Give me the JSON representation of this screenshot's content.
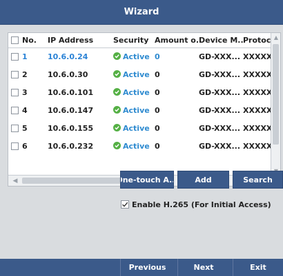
{
  "window": {
    "title": "Wizard"
  },
  "table": {
    "headers": {
      "no": "No.",
      "ip": "IP Address",
      "security": "Security",
      "amount": "Amount o...",
      "device_model": "Device M...",
      "protocol": "Protocol"
    },
    "rows": [
      {
        "no": "1",
        "ip": "10.6.0.24",
        "security": "Active",
        "amount": "0",
        "device_model": "GD-XXX...",
        "protocol": "XXXXXX"
      },
      {
        "no": "2",
        "ip": "10.6.0.30",
        "security": "Active",
        "amount": "0",
        "device_model": "GD-XXX...",
        "protocol": "XXXXXX"
      },
      {
        "no": "3",
        "ip": "10.6.0.101",
        "security": "Active",
        "amount": "0",
        "device_model": "GD-XXX...",
        "protocol": "XXXXXX"
      },
      {
        "no": "4",
        "ip": "10.6.0.147",
        "security": "Active",
        "amount": "0",
        "device_model": "GD-XXX...",
        "protocol": "XXXXXX"
      },
      {
        "no": "5",
        "ip": "10.6.0.155",
        "security": "Active",
        "amount": "0",
        "device_model": "GD-XXX...",
        "protocol": "XXXXXX"
      },
      {
        "no": "6",
        "ip": "10.6.0.232",
        "security": "Active",
        "amount": "0",
        "device_model": "GD-XXX...",
        "protocol": "XXXXXX"
      }
    ],
    "selected_row": 1
  },
  "actions": {
    "one_touch": "One-touch A...",
    "add": "Add",
    "search": "Search"
  },
  "options": {
    "h265_label": "Enable H.265 (For Initial Access)",
    "h265_checked": true
  },
  "footer": {
    "previous": "Previous",
    "next": "Next",
    "exit": "Exit"
  },
  "colors": {
    "accent": "#3b5a8a",
    "selected_text": "#2b83d6",
    "active_text": "#2f8bd0",
    "active_icon": "#55b045"
  }
}
